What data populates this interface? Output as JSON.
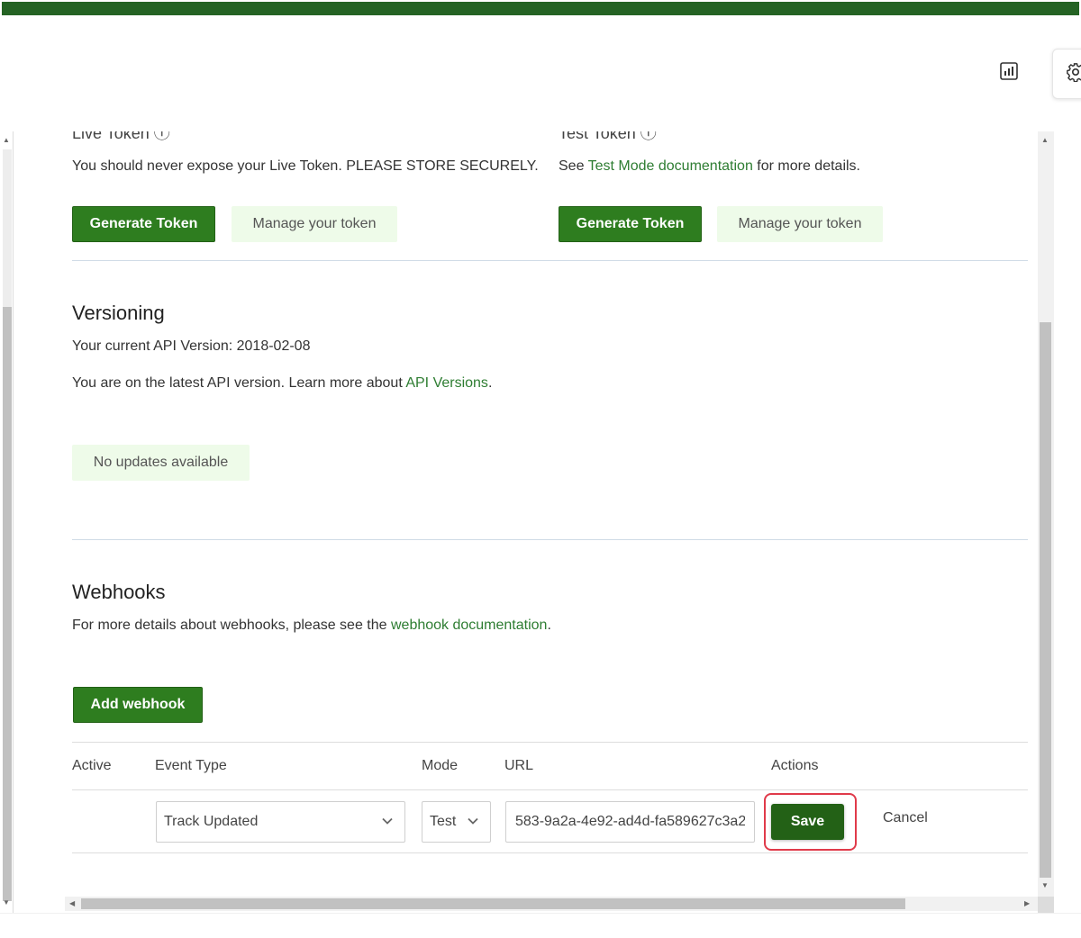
{
  "tokens": {
    "live": {
      "title_fragment": "Live Token",
      "description": "You should never expose your Live Token. PLEASE STORE SECURELY.",
      "generate_label": "Generate Token",
      "manage_label": "Manage your token"
    },
    "test": {
      "title_fragment": "Test Token",
      "description_prefix": "See ",
      "description_link": "Test Mode documentation",
      "description_suffix": " for more details.",
      "generate_label": "Generate Token",
      "manage_label": "Manage your token"
    }
  },
  "versioning": {
    "title": "Versioning",
    "current_version": "Your current API Version: 2018-02-08",
    "latest_prefix": "You are on the latest API version. Learn more about ",
    "latest_link": "API Versions",
    "latest_suffix": ".",
    "status_label": "No updates available"
  },
  "webhooks": {
    "title": "Webhooks",
    "description_prefix": "For more details about webhooks, please see the ",
    "description_link": "webhook documentation",
    "description_suffix": ".",
    "add_label": "Add webhook",
    "table": {
      "headers": {
        "active": "Active",
        "event_type": "Event Type",
        "mode": "Mode",
        "url": "URL",
        "actions": "Actions"
      },
      "edit_row": {
        "event_type": "Track Updated",
        "mode": "Test",
        "url": "583-9a2a-4e92-ad4d-fa589627c3a2",
        "save_label": "Save",
        "cancel_label": "Cancel"
      }
    }
  },
  "colors": {
    "brand": "#256324",
    "primary_button": "#2e7d1f",
    "soft_button": "#eefbe9",
    "link": "#2e7d32",
    "highlight": "#e03a4a"
  },
  "icons": {
    "header_report": "bar-chart-icon",
    "header_settings": "gear-icon",
    "select_chevron": "chevron-down-icon"
  }
}
